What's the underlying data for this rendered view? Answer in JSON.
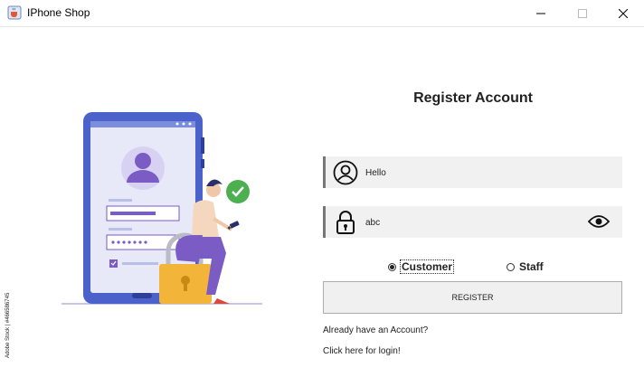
{
  "window": {
    "title": "IPhone Shop",
    "icon": "java-cup-icon"
  },
  "illustration": {
    "watermark_text": "Adobe Stock | #466586745"
  },
  "form": {
    "title": "Register Account",
    "username": {
      "value": "Hello",
      "icon": "user-icon"
    },
    "password": {
      "value": "abc",
      "icon": "lock-icon",
      "toggle_icon": "eye-icon"
    },
    "roles": [
      {
        "label": "Customer",
        "selected": true
      },
      {
        "label": "Staff",
        "selected": false
      }
    ],
    "register_label": "REGISTER",
    "already_text": "Already have an Account?",
    "login_link": "Click here for login!"
  },
  "colors": {
    "phone_body": "#4a62c9",
    "accent_purple": "#7b5cc4",
    "padlock": "#f2b53a",
    "check_green": "#4caf50",
    "field_bg": "#f1f1f1"
  }
}
